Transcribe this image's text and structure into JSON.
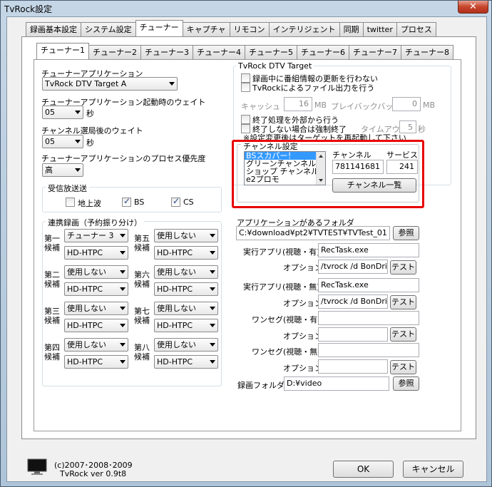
{
  "window": {
    "title": "TvRock設定",
    "close_glyph": "✕"
  },
  "main_tabs": [
    "録画基本設定",
    "システム設定",
    "チューナー",
    "キャプチャ",
    "リモコン",
    "インテリジェント",
    "同期",
    "twitter",
    "プロセス"
  ],
  "sub_tabs": [
    "チューナー1",
    "チューナー2",
    "チューナー3",
    "チューナー4",
    "チューナー5",
    "チューナー6",
    "チューナー7",
    "チューナー8"
  ],
  "left": {
    "app_label": "チューナーアプリケーション",
    "app_value": "TvRock DTV Target A",
    "wait_label": "チューナーアプリケーション起動時のウェイト",
    "wait_value": "05",
    "wait_unit": "秒",
    "ch_wait_label": "チャンネル選局後のウェイト",
    "ch_wait_value": "05",
    "ch_wait_unit": "秒",
    "priority_label": "チューナーアプリケーションのプロセス優先度",
    "priority_value": "高",
    "receive_group": "受信放送送",
    "receive": [
      {
        "label": "地上波",
        "checked": false
      },
      {
        "label": "BS",
        "checked": true
      },
      {
        "label": "CS",
        "checked": true
      }
    ],
    "link_group": "連携録画（予約振り分け）",
    "candidates": [
      {
        "label1": "第一",
        "label2": "候補",
        "tuner": "チューナー 3",
        "device": "HD-HTPC"
      },
      {
        "label1": "第二",
        "label2": "候補",
        "tuner": "使用しない",
        "device": "HD-HTPC"
      },
      {
        "label1": "第三",
        "label2": "候補",
        "tuner": "使用しない",
        "device": "HD-HTPC"
      },
      {
        "label1": "第四",
        "label2": "候補",
        "tuner": "使用しない",
        "device": "HD-HTPC"
      },
      {
        "label1": "第五",
        "label2": "候補",
        "tuner": "使用しない",
        "device": "HD-HTPC"
      },
      {
        "label1": "第六",
        "label2": "候補",
        "tuner": "使用しない",
        "device": "HD-HTPC"
      },
      {
        "label1": "第七",
        "label2": "候補",
        "tuner": "使用しない",
        "device": "HD-HTPC"
      },
      {
        "label1": "第八",
        "label2": "候補",
        "tuner": "使用しない",
        "device": "HD-HTPC"
      }
    ]
  },
  "right": {
    "dtv_group": "TvRock DTV Target",
    "opt_no_update": "録画中に番組情報の更新を行わない",
    "opt_file_output": "TvRockによるファイル出力を行う",
    "cache_label": "キャッシュ",
    "cache_value": "16",
    "cache_unit": "MB",
    "playback_label": "プレイバックバッファ",
    "playback_value": "0",
    "playback_unit": "MB",
    "opt_external_end": "終了処理を外部から行う",
    "opt_force_end": "終了しない場合は強制終了",
    "timeout_label": "タイムアウト",
    "timeout_value": "5",
    "timeout_unit": "秒",
    "note": "※設定変更後はターゲットを再起動して下さい",
    "channel_group": "チャンネル設定",
    "channel_list": [
      "BSスカパー！",
      "グリーンチャンネル",
      "ショップ チャンネル",
      "e2プロモ"
    ],
    "channel_header": "チャンネル",
    "service_header": "サービス",
    "channel_value": "781141681",
    "service_value": "241",
    "channel_list_button": "チャンネル一覧",
    "app_folder_label": "アプリケーションがあるフォルダ",
    "app_folder_value": "C:¥download¥pt2¥TVTEST¥TVTest_01",
    "browse": "参照",
    "exec_view_label": "実行アプリ(視聴・有)",
    "exec_view_value": "RecTask.exe",
    "option_label": "オプション",
    "option_view_value": "/tvrock /d BonDriv",
    "test": "テスト",
    "exec_noview_label": "実行アプリ(視聴・無)",
    "exec_noview_value": "RecTask.exe",
    "option_noview_value": "/tvrock /d BonDriv",
    "oneseg_view_label": "ワンセグ(視聴・有)",
    "oneseg_noview_label": "ワンセグ(視聴・無)",
    "rec_folder_label": "録画フォルダ",
    "rec_folder_value": "D:¥video"
  },
  "footer": {
    "copyright": "(c)2007･2008･2009",
    "version": "TvRock ver 0.9t8",
    "ok": "OK",
    "cancel": "キャンセル"
  }
}
